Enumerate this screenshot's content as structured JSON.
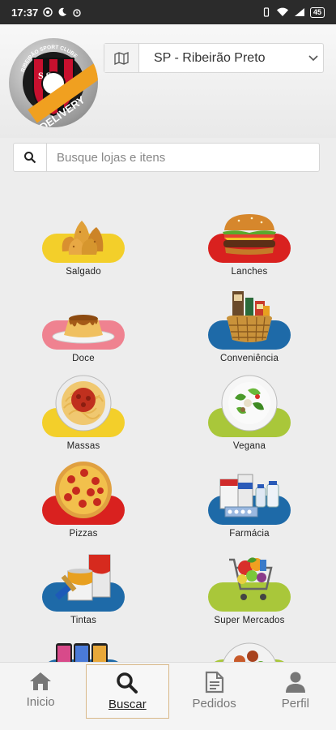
{
  "status_bar": {
    "time": "17:37",
    "battery": "45"
  },
  "header": {
    "logo": {
      "ring_text": "RIBEIRÃO SPORT CLUBE",
      "letters": "S S",
      "ribbon": "DELIVERY"
    },
    "city_select": {
      "value": "SP - Ribeirão Preto"
    }
  },
  "search": {
    "placeholder": "Busque lojas e itens"
  },
  "categories": [
    {
      "label": "Salgado",
      "color": "#f3cf2a",
      "icon": "coxinha-food"
    },
    {
      "label": "Lanches",
      "color": "#d9211f",
      "icon": "burger-food"
    },
    {
      "label": "Doce",
      "color": "#ef8290",
      "icon": "pudding-food"
    },
    {
      "label": "Conveniência",
      "color": "#1e6aa8",
      "icon": "basket-food"
    },
    {
      "label": "Massas",
      "color": "#f3cf2a",
      "icon": "spaghetti-food"
    },
    {
      "label": "Vegana",
      "color": "#a9c73a",
      "icon": "salad-food"
    },
    {
      "label": "Pizzas",
      "color": "#d9211f",
      "icon": "pizza-food"
    },
    {
      "label": "Farmácia",
      "color": "#1e6aa8",
      "icon": "medicine-food"
    },
    {
      "label": "Tintas",
      "color": "#1e6aa8",
      "icon": "paint-can"
    },
    {
      "label": "Super Mercados",
      "color": "#a9c73a",
      "icon": "shopping-cart"
    },
    {
      "label": "",
      "color": "#1e6aa8",
      "icon": "phones"
    },
    {
      "label": "",
      "color": "#a9c73a",
      "icon": "meat-plate"
    }
  ],
  "bottom_nav": [
    {
      "label": "Inicio",
      "icon": "home-icon",
      "active": false
    },
    {
      "label": "Buscar",
      "icon": "search-icon",
      "active": true
    },
    {
      "label": "Pedidos",
      "icon": "document-icon",
      "active": false
    },
    {
      "label": "Perfil",
      "icon": "user-icon",
      "active": false
    }
  ]
}
